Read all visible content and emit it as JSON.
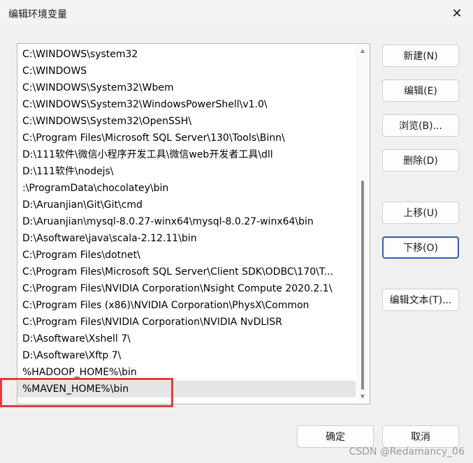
{
  "window": {
    "title": "编辑环境变量",
    "close_glyph": "✕"
  },
  "paths": [
    "C:\\WINDOWS\\system32",
    "C:\\WINDOWS",
    "C:\\WINDOWS\\System32\\Wbem",
    "C:\\WINDOWS\\System32\\WindowsPowerShell\\v1.0\\",
    "C:\\WINDOWS\\System32\\OpenSSH\\",
    "C:\\Program Files\\Microsoft SQL Server\\130\\Tools\\Binn\\",
    "D:\\111软件\\微信小程序开发工具\\微信web开发者工具\\dll",
    "D:\\111软件\\nodejs\\",
    ":\\ProgramData\\chocolatey\\bin",
    "D:\\Aruanjian\\Git\\Git\\cmd",
    "D:\\Aruanjian\\mysql-8.0.27-winx64\\mysql-8.0.27-winx64\\bin",
    "D:\\Asoftware\\java\\scala-2.12.11\\bin",
    "C:\\Program Files\\dotnet\\",
    "C:\\Program Files\\Microsoft SQL Server\\Client SDK\\ODBC\\170\\T...",
    "C:\\Program Files\\NVIDIA Corporation\\Nsight Compute 2020.2.1\\",
    "C:\\Program Files (x86)\\NVIDIA Corporation\\PhysX\\Common",
    "C:\\Program Files\\NVIDIA Corporation\\NVIDIA NvDLISR",
    "D:\\Asoftware\\Xshell 7\\",
    "D:\\Asoftware\\Xftp 7\\",
    "%HADOOP_HOME%\\bin",
    "%MAVEN_HOME%\\bin"
  ],
  "selected_index": 20,
  "buttons": {
    "new": "新建(N)",
    "edit": "编辑(E)",
    "browse": "浏览(B)...",
    "delete": "删除(D)",
    "move_up": "上移(U)",
    "move_down": "下移(O)",
    "edit_text": "编辑文本(T)...",
    "ok": "确定",
    "cancel": "取消"
  },
  "watermark": "CSDN @Redamancy_06",
  "colors": {
    "highlight_box": "#e8393a",
    "default_button_border": "#2a5fb0"
  }
}
